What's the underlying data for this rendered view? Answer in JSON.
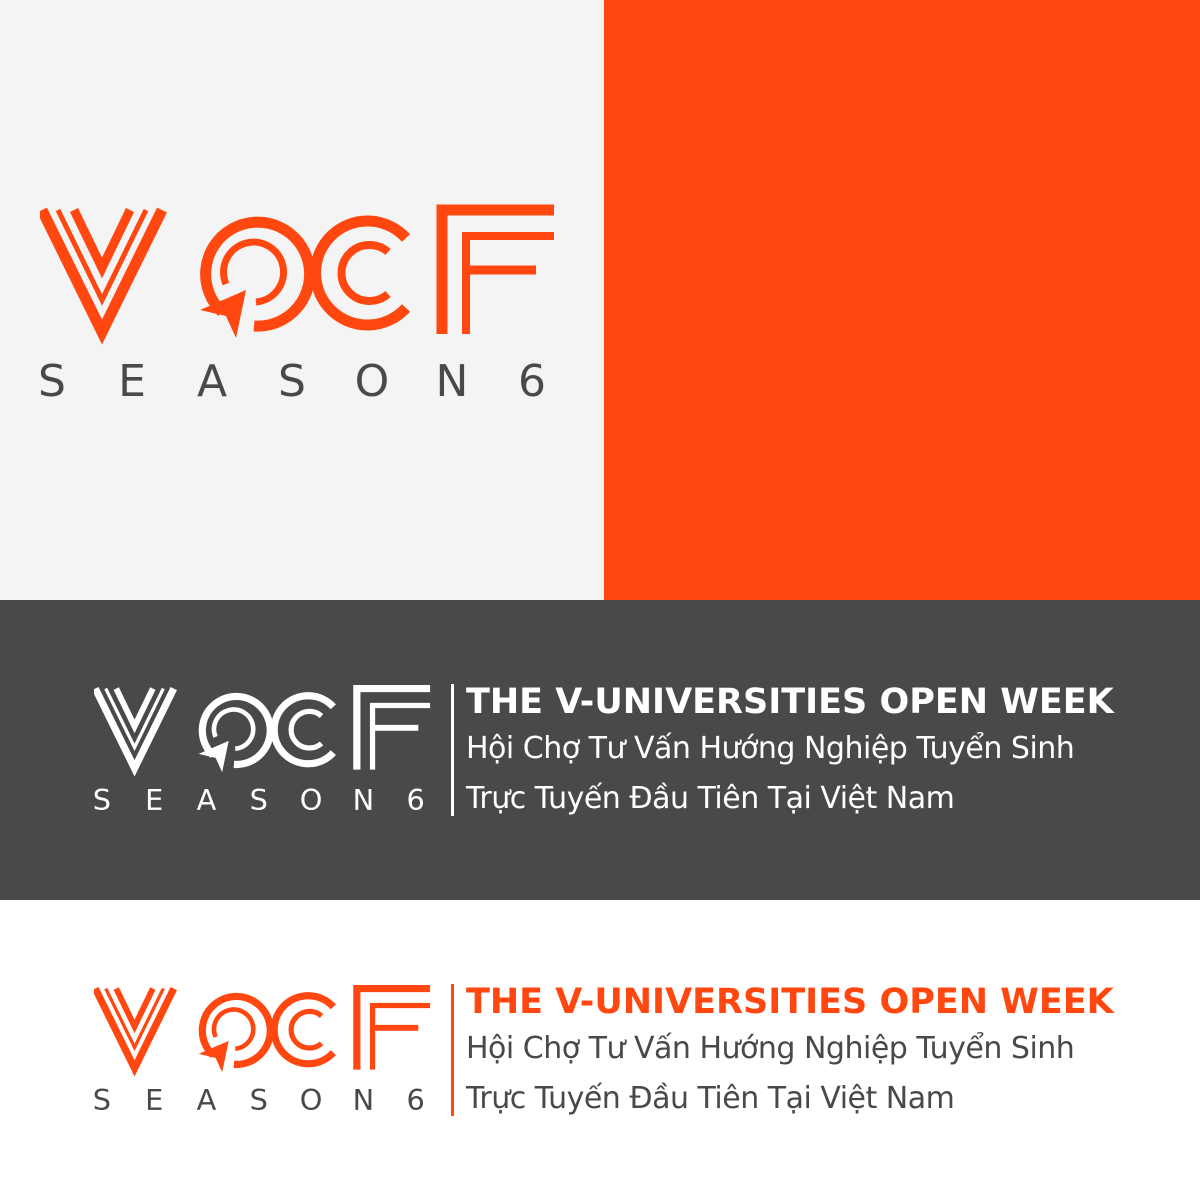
{
  "brand": {
    "wordmark": "VOCF",
    "season_label": "SEASON 6",
    "season_letters": [
      "S",
      "E",
      "A",
      "S",
      "O",
      "N",
      "6"
    ]
  },
  "tagline": {
    "title": "THE V-UNIVERSITIES OPEN WEEK",
    "line1": "Hội Chợ Tư Vấn Hướng Nghiệp Tuyển Sinh",
    "line2": "Trực Tuyến Đầu Tiên Tại Việt Nam"
  },
  "colors": {
    "orange": "#ff470f",
    "dark_gray": "#4a494a",
    "light_gray": "#f4f4f4",
    "white": "#ffffff"
  },
  "icon": "cursor-arrow-in-circle-icon"
}
